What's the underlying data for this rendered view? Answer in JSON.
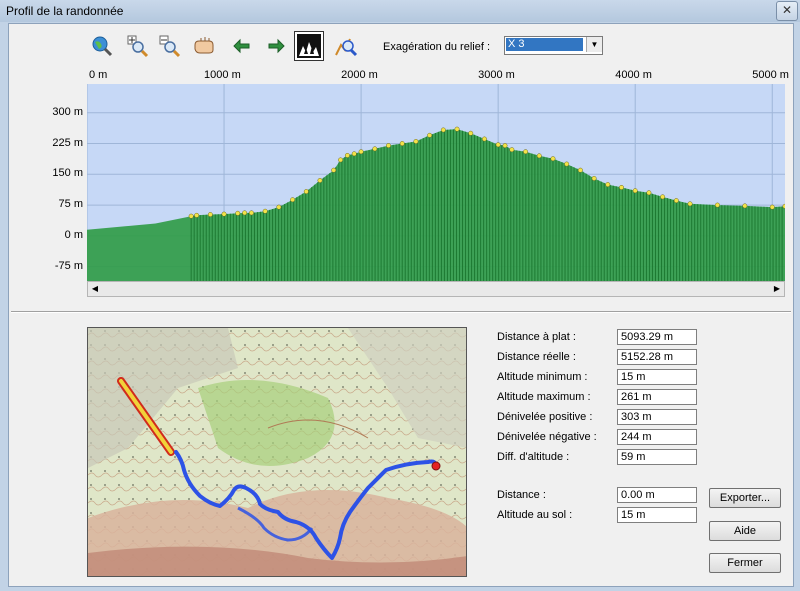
{
  "window": {
    "title": "Profil de la randonnée",
    "close_glyph": "✕"
  },
  "toolbar": {
    "relief_label": "Exagération du relief :",
    "relief_value": "X 3",
    "buttons": [
      {
        "name": "zoom-fit-button",
        "icon": "globe-magnifier-icon"
      },
      {
        "name": "zoom-in-button",
        "icon": "zoom-in-icon"
      },
      {
        "name": "zoom-out-button",
        "icon": "zoom-out-icon"
      },
      {
        "name": "pan-button",
        "icon": "hand-icon"
      },
      {
        "name": "back-button",
        "icon": "arrow-left-icon"
      },
      {
        "name": "forward-button",
        "icon": "arrow-right-icon"
      },
      {
        "name": "relief-view-button",
        "icon": "forest-relief-icon",
        "active": true
      },
      {
        "name": "measure-button",
        "icon": "profile-magnifier-icon"
      }
    ]
  },
  "chart_data": {
    "type": "area",
    "x_tick_labels": [
      "0 m",
      "1000 m",
      "2000 m",
      "3000 m",
      "4000 m",
      "5000 m"
    ],
    "y_tick_labels": [
      "300 m",
      "225 m",
      "150 m",
      "75 m",
      "0 m",
      "-75 m"
    ],
    "x_unit": "m",
    "y_unit": "m",
    "xlim": [
      0,
      5093
    ],
    "ylim": [
      -110,
      370
    ],
    "grid": true,
    "colors": {
      "plot_bg": "#c6d8f6",
      "fill": "#2e9b45",
      "fill_dark": "#1d7a32",
      "marker": "#f2e34a"
    },
    "x": [
      0,
      500,
      760,
      800,
      900,
      1000,
      1100,
      1150,
      1200,
      1300,
      1400,
      1500,
      1600,
      1700,
      1800,
      1850,
      1900,
      1950,
      2000,
      2100,
      2200,
      2300,
      2400,
      2500,
      2600,
      2700,
      2800,
      2900,
      3000,
      3050,
      3100,
      3200,
      3300,
      3400,
      3500,
      3600,
      3700,
      3800,
      3900,
      4000,
      4100,
      4200,
      4300,
      4400,
      4600,
      4800,
      5000,
      5093
    ],
    "y": [
      15,
      30,
      48,
      50,
      52,
      53,
      55,
      56,
      56,
      60,
      70,
      88,
      108,
      135,
      160,
      185,
      196,
      200,
      205,
      212,
      220,
      225,
      230,
      245,
      258,
      260,
      250,
      236,
      222,
      220,
      210,
      205,
      195,
      188,
      175,
      160,
      140,
      125,
      118,
      110,
      105,
      95,
      86,
      78,
      75,
      73,
      70,
      72
    ]
  },
  "map": {
    "colors": {
      "route": "#2d52e6",
      "segment": "#f1d23a",
      "segment_edge": "#d12b1c",
      "end_point": "#e32222"
    }
  },
  "stats": [
    {
      "label": "Distance à plat :",
      "value": "5093.29 m"
    },
    {
      "label": "Distance réelle :",
      "value": "5152.28 m"
    },
    {
      "label": "Altitude minimum :",
      "value": "15 m"
    },
    {
      "label": "Altitude maximum :",
      "value": "261 m"
    },
    {
      "label": "Dénivelée positive :",
      "value": "303 m"
    },
    {
      "label": "Dénivelée négative :",
      "value": "244 m"
    },
    {
      "label": "Diff. d'altitude :",
      "value": "59 m"
    }
  ],
  "cursor": [
    {
      "label": "Distance :",
      "value": "0.00 m"
    },
    {
      "label": "Altitude au sol :",
      "value": "15 m"
    }
  ],
  "actions": {
    "export_label": "Exporter...",
    "help_label": "Aide",
    "close_label": "Fermer"
  }
}
